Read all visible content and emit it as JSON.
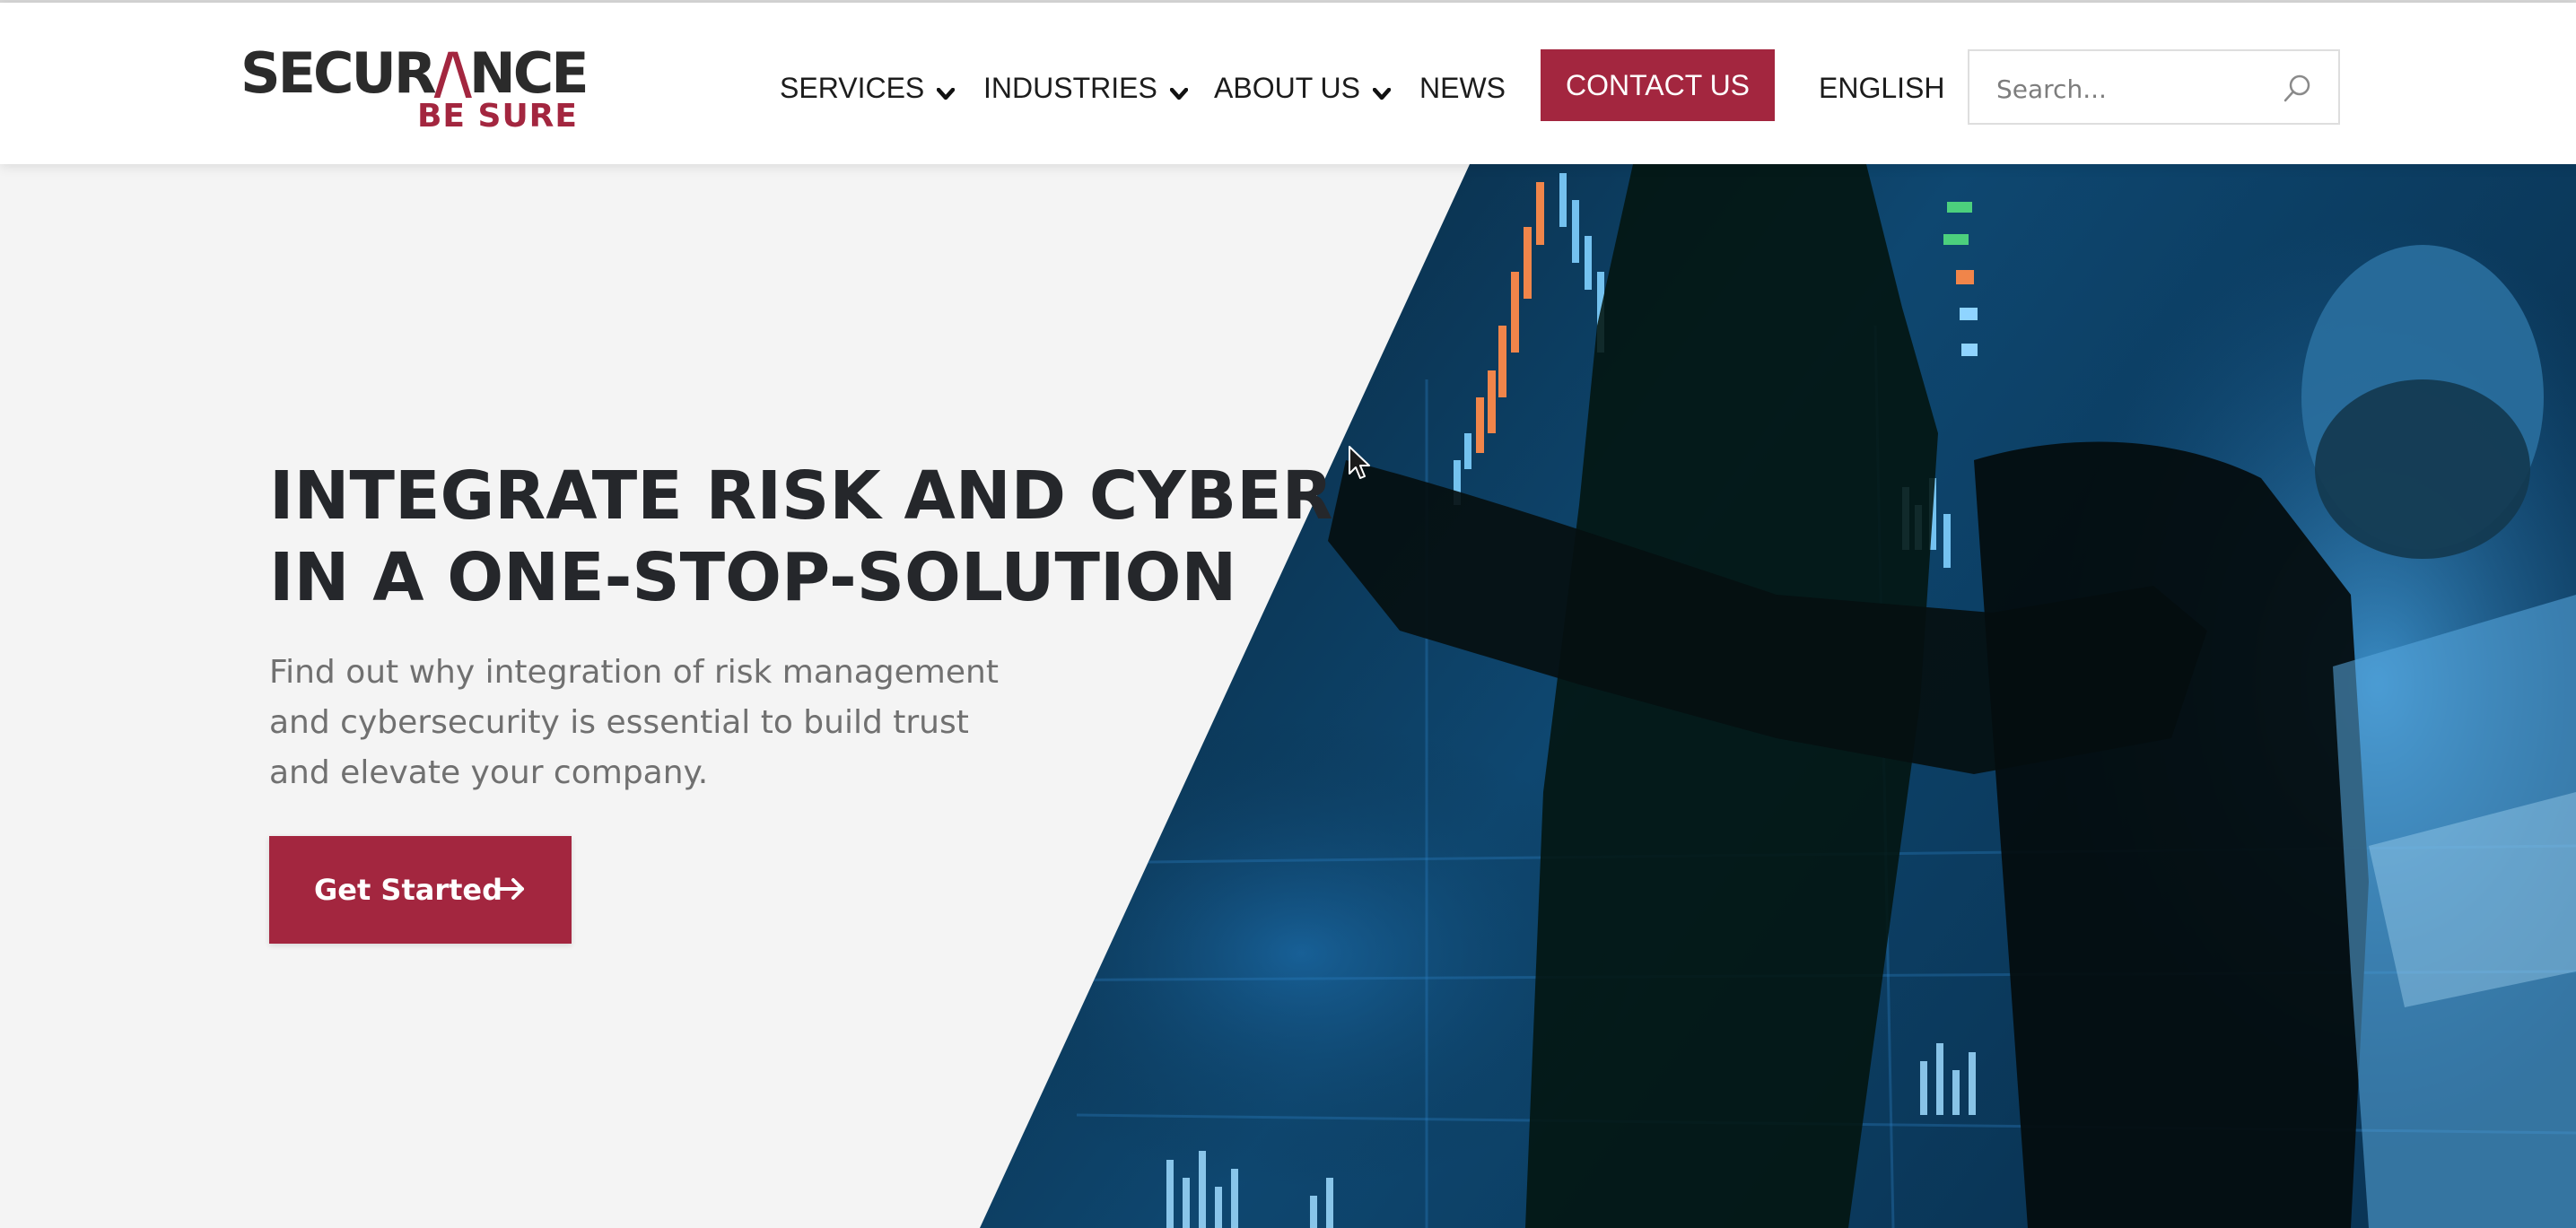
{
  "header": {
    "logo": {
      "name": "SECURANCE",
      "tagline": "BE SURE"
    },
    "nav": [
      {
        "label": "SERVICES",
        "has_dropdown": true,
        "icon": "chevron-down-icon"
      },
      {
        "label": "INDUSTRIES",
        "has_dropdown": true,
        "icon": "chevron-down-icon"
      },
      {
        "label": "ABOUT US",
        "has_dropdown": true,
        "icon": "chevron-down-icon"
      },
      {
        "label": "NEWS",
        "has_dropdown": false
      }
    ],
    "contact_label": "CONTACT US",
    "language_label": "ENGLISH",
    "search": {
      "placeholder": "Search...",
      "value": "",
      "icon": "search-icon"
    }
  },
  "hero": {
    "title_lines": [
      "INTEGRATE RISK AND CYBER",
      "IN A ONE-STOP-SOLUTION"
    ],
    "subtitle_lines": [
      "Find out why integration of risk management",
      "and cybersecurity is essential to build trust",
      "and elevate your company."
    ],
    "cta_label": "Get Started",
    "cta_icon": "arrow-right-icon",
    "image": "trader-at-stock-chart-screens-photo"
  },
  "colors": {
    "brand": "#a3263f",
    "text_dark": "#25272b",
    "text_muted": "#707070",
    "hero_background": "#f4f4f4",
    "header_background": "#ffffff"
  }
}
